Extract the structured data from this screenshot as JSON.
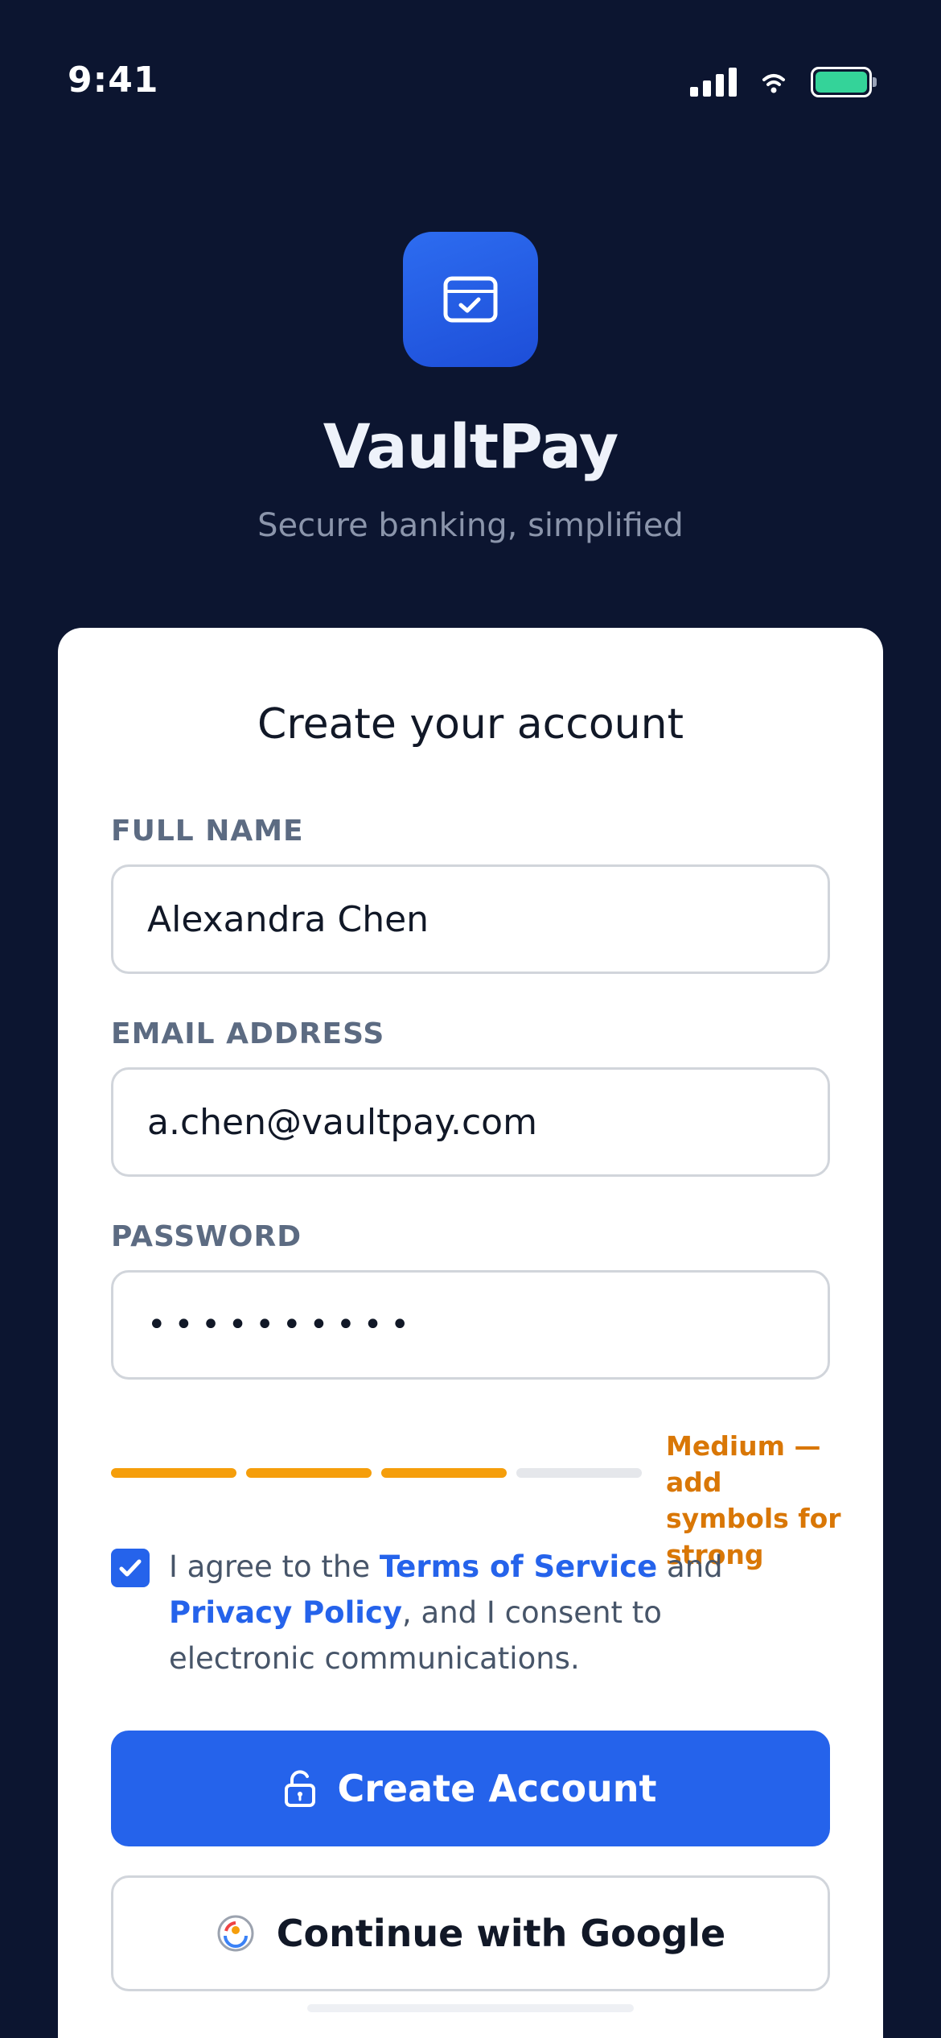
{
  "status_bar": {
    "time": "9:41"
  },
  "brand": {
    "name": "VaultPay",
    "tagline": "Secure banking, simplified",
    "logo_icon": "card-check-icon",
    "accent_color": "#2563eb"
  },
  "form": {
    "title": "Create your account",
    "fields": {
      "full_name": {
        "label": "FULL NAME",
        "value": "Alexandra Chen"
      },
      "email": {
        "label": "EMAIL ADDRESS",
        "value": "a.chen@vaultpay.com"
      },
      "password": {
        "label": "PASSWORD",
        "value": "••••••••••"
      }
    },
    "password_strength": {
      "level": 3,
      "max": 4,
      "text": "Medium — add symbols for strong",
      "color": "#f59e0b"
    },
    "consent": {
      "checked": true,
      "prefix": "I agree to the ",
      "terms_link": "Terms of Service",
      "middle": " and ",
      "privacy_link": "Privacy Policy",
      "suffix": ", and I consent to electronic communications."
    },
    "primary_button": {
      "label": "Create Account",
      "icon": "lock-icon"
    },
    "secondary_button": {
      "label": "Continue with Google",
      "icon": "google-icon"
    }
  }
}
